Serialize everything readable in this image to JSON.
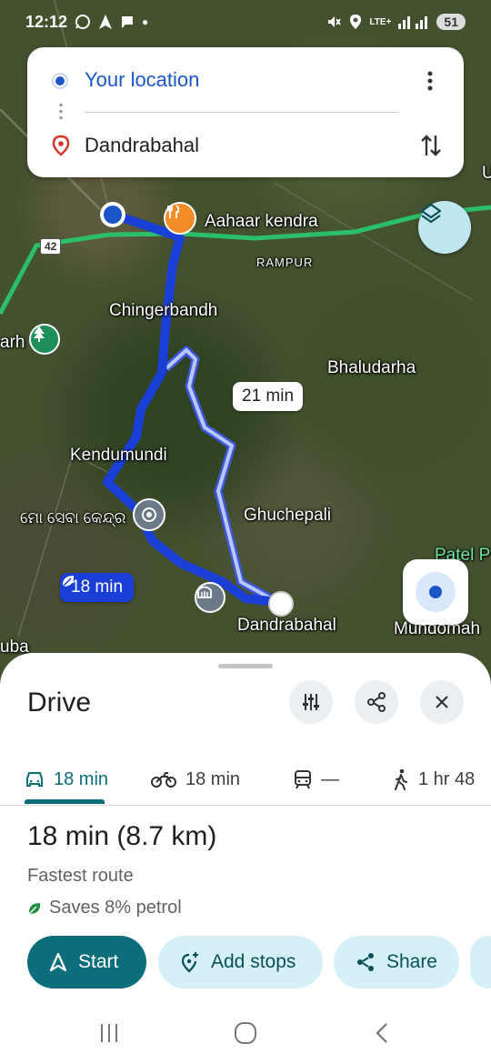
{
  "status_bar": {
    "time": "12:12",
    "network": "LTE+",
    "battery": "51"
  },
  "search": {
    "origin": "Your location",
    "destination": "Dandrabahal"
  },
  "map": {
    "labels": {
      "aahaar": "Aahaar kendra",
      "rampur": "RAMPUR",
      "chingerbandh": "Chingerbandh",
      "arh": "arh",
      "bhaludarha": "Bhaludarha",
      "kendumundi": "Kendumundi",
      "mo_seba": "ମୋ ସେବା କେନ୍ଦ୍ର",
      "ghuchepali": "Ghuchepali",
      "patel": "Patel P",
      "dandrabahal": "Dandrabahal",
      "mundomah": "Mundomah",
      "uba": "uba",
      "partial_u": "U"
    },
    "road_number": "42",
    "alt_route_time": "21 min",
    "main_route_time": "18 min"
  },
  "sheet": {
    "title": "Drive",
    "modes": [
      {
        "icon": "car-icon",
        "label": "18 min"
      },
      {
        "icon": "motorbike-icon",
        "label": "18 min"
      },
      {
        "icon": "train-icon",
        "label": "—"
      },
      {
        "icon": "walk-icon",
        "label": "1 hr 48"
      }
    ],
    "route_time": "18 min",
    "route_distance": "(8.7 km)",
    "route_desc": "Fastest route",
    "route_eco": "Saves 8% petrol",
    "actions": {
      "start": "Start",
      "add_stops": "Add stops",
      "share": "Share"
    }
  },
  "colors": {
    "accent": "#0b6e7a",
    "route_primary": "#1a3fd6",
    "chip_bg": "#d5f0f7",
    "blue_text": "#1a56c8"
  }
}
